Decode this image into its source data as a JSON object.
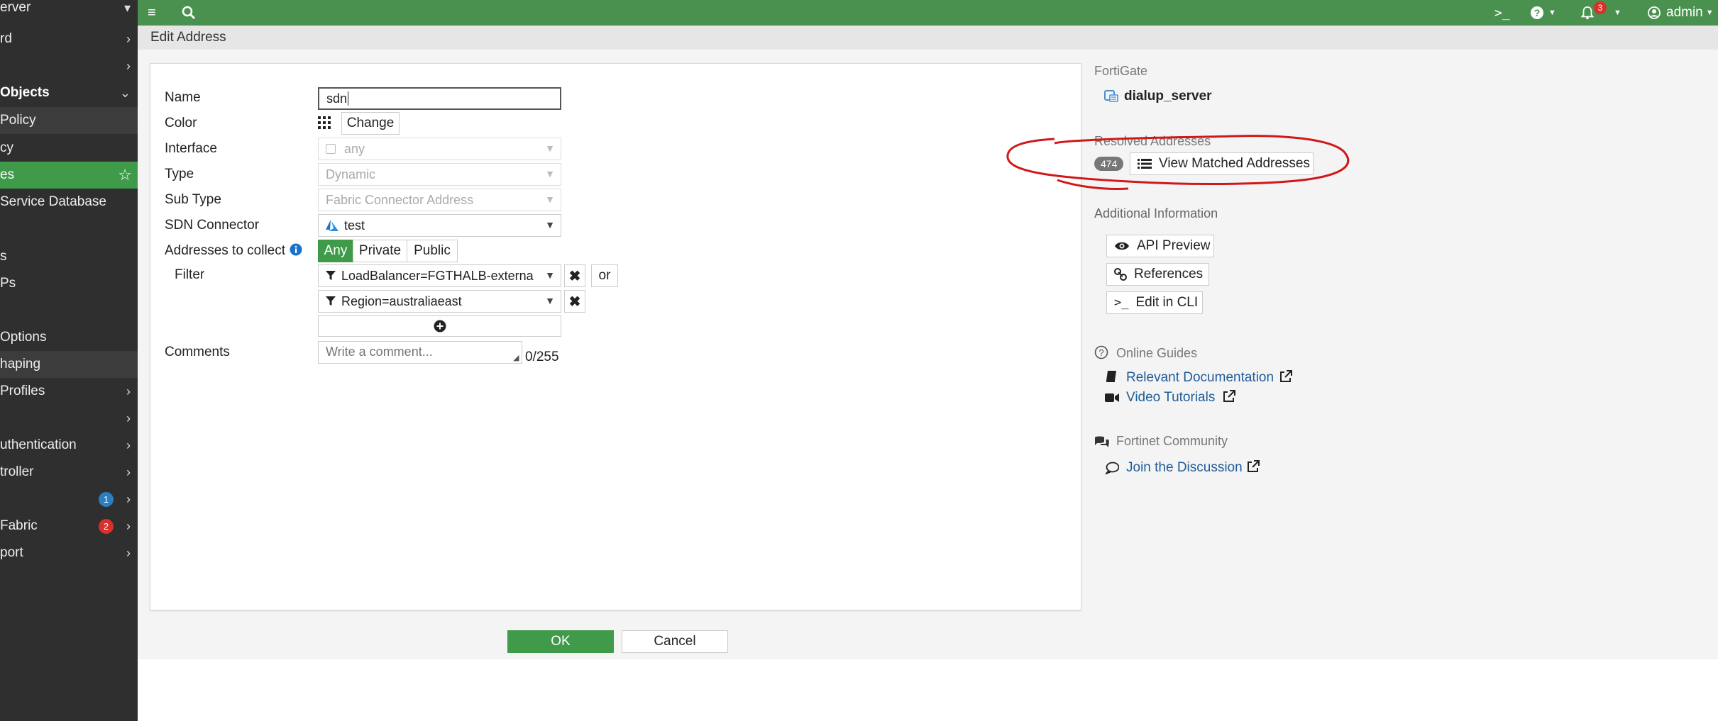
{
  "sidebar": {
    "items": [
      {
        "label": "erver"
      },
      {
        "label": "rd"
      },
      {
        "label": ""
      },
      {
        "label": "Objects"
      },
      {
        "label": "Policy"
      },
      {
        "label": "cy"
      },
      {
        "label": "es"
      },
      {
        "label": "Service Database"
      },
      {
        "label": "s"
      },
      {
        "label": "Ps"
      },
      {
        "label": "Options"
      },
      {
        "label": "haping"
      },
      {
        "label": "Profiles"
      },
      {
        "label": ""
      },
      {
        "label": "uthentication"
      },
      {
        "label": "troller"
      },
      {
        "label": "",
        "badge": "1",
        "badge_color": "#2a7fc1"
      },
      {
        "label": "Fabric",
        "badge": "2",
        "badge_color": "#d8302a"
      },
      {
        "label": "port"
      }
    ]
  },
  "topbar": {
    "notif_count": "3",
    "user": "admin"
  },
  "header": {
    "title": "Edit Address"
  },
  "form": {
    "name_label": "Name",
    "name_value": "sdn",
    "color_label": "Color",
    "color_change": "Change",
    "interface_label": "Interface",
    "interface_value": "any",
    "type_label": "Type",
    "type_value": "Dynamic",
    "subtype_label": "Sub Type",
    "subtype_value": "Fabric Connector Address",
    "sdn_label": "SDN Connector",
    "sdn_value": "test",
    "collect_label": "Addresses to collect",
    "collect_options": [
      "Any",
      "Private",
      "Public"
    ],
    "filter_label": "Filter",
    "filter_1": "LoadBalancer=FGTHALB-externa",
    "filter_2": "Region=australiaeast",
    "or_label": "or",
    "comments_label": "Comments",
    "comments_placeholder": "Write a comment...",
    "comments_count": "0/255"
  },
  "right_panel": {
    "fortigate_head": "FortiGate",
    "fortigate_device": "dialup_server",
    "resolved_head": "Resolved Addresses",
    "resolved_count": "474",
    "view_matched": "View Matched Addresses",
    "additional_head": "Additional Information",
    "api_preview": "API Preview",
    "references": "References",
    "edit_cli": "Edit in CLI",
    "guides_head": "Online Guides",
    "relevant_doc": "Relevant Documentation",
    "video_tutorials": "Video Tutorials",
    "community_head": "Fortinet Community",
    "join_discussion": "Join the Discussion"
  },
  "footer": {
    "ok": "OK",
    "cancel": "Cancel"
  },
  "colors": {
    "accent": "#3f9a4a",
    "topbar": "#4a9150",
    "sidebar": "#2f2f2f",
    "link": "#1f5c99",
    "annotation": "#d01818"
  }
}
